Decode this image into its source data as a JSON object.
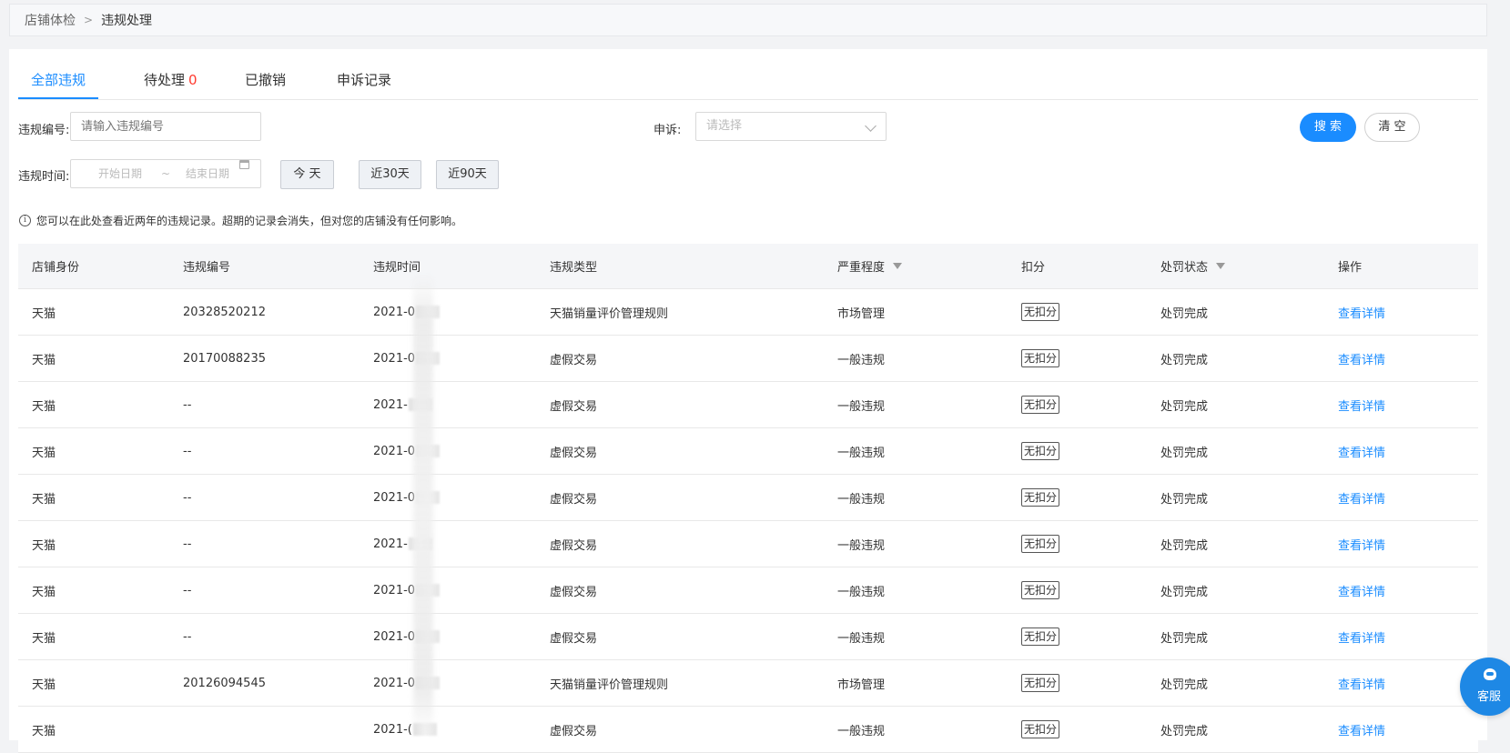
{
  "breadcrumb": {
    "parent": "店铺体检",
    "separator": ">",
    "current": "违规处理"
  },
  "tabs": [
    {
      "label": "全部违规"
    },
    {
      "label": "待处理",
      "count": "0"
    },
    {
      "label": "已撤销"
    },
    {
      "label": "申诉记录"
    }
  ],
  "filters": {
    "violation_id_label": "违规编号:",
    "violation_id_placeholder": "请输入违规编号",
    "appeal_label": "申诉:",
    "appeal_placeholder": "请选择",
    "search_label": "搜 索",
    "clear_label": "清 空",
    "time_label": "违规时间:",
    "start_placeholder": "开始日期",
    "range_sep": "~",
    "end_placeholder": "结束日期",
    "quick": [
      "今 天",
      "近30天",
      "近90天"
    ]
  },
  "notice": "您可以在此处查看近两年的违规记录。超期的记录会消失，但对您的店铺没有任何影响。",
  "table": {
    "headers": [
      "店铺身份",
      "违规编号",
      "违规时间",
      "违规类型",
      "严重程度",
      "扣分",
      "处罚状态",
      "操作"
    ],
    "rows": [
      {
        "store": "天猫",
        "id": "20328520212",
        "time": "2021-0",
        "type": "天猫销量评价管理规则",
        "severity": "市场管理",
        "score": "无扣分",
        "status": "处罚完成",
        "action": "查看详情"
      },
      {
        "store": "天猫",
        "id": "20170088235",
        "time": "2021-0",
        "type": "虚假交易",
        "severity": "一般违规",
        "score": "无扣分",
        "status": "处罚完成",
        "action": "查看详情"
      },
      {
        "store": "天猫",
        "id": "--",
        "time": "2021-",
        "type": "虚假交易",
        "severity": "一般违规",
        "score": "无扣分",
        "status": "处罚完成",
        "action": "查看详情"
      },
      {
        "store": "天猫",
        "id": "--",
        "time": "2021-0",
        "type": "虚假交易",
        "severity": "一般违规",
        "score": "无扣分",
        "status": "处罚完成",
        "action": "查看详情"
      },
      {
        "store": "天猫",
        "id": "--",
        "time": "2021-0",
        "type": "虚假交易",
        "severity": "一般违规",
        "score": "无扣分",
        "status": "处罚完成",
        "action": "查看详情"
      },
      {
        "store": "天猫",
        "id": "--",
        "time": "2021-",
        "type": "虚假交易",
        "severity": "一般违规",
        "score": "无扣分",
        "status": "处罚完成",
        "action": "查看详情"
      },
      {
        "store": "天猫",
        "id": "--",
        "time": "2021-0",
        "type": "虚假交易",
        "severity": "一般违规",
        "score": "无扣分",
        "status": "处罚完成",
        "action": "查看详情"
      },
      {
        "store": "天猫",
        "id": "--",
        "time": "2021-0",
        "type": "虚假交易",
        "severity": "一般违规",
        "score": "无扣分",
        "status": "处罚完成",
        "action": "查看详情"
      },
      {
        "store": "天猫",
        "id": "20126094545",
        "time": "2021-0",
        "type": "天猫销量评价管理规则",
        "severity": "市场管理",
        "score": "无扣分",
        "status": "处罚完成",
        "action": "查看详情"
      },
      {
        "store": "天猫",
        "id": "",
        "time": "2021-(",
        "type": "虚假交易",
        "severity": "一般违规",
        "score": "无扣分",
        "status": "处罚完成",
        "action": "查看详情"
      }
    ]
  },
  "customer_service": {
    "label": "客服",
    "icon": "headset-icon"
  },
  "colors": {
    "accent": "#1a8cff",
    "count_red": "#ff3b30"
  }
}
